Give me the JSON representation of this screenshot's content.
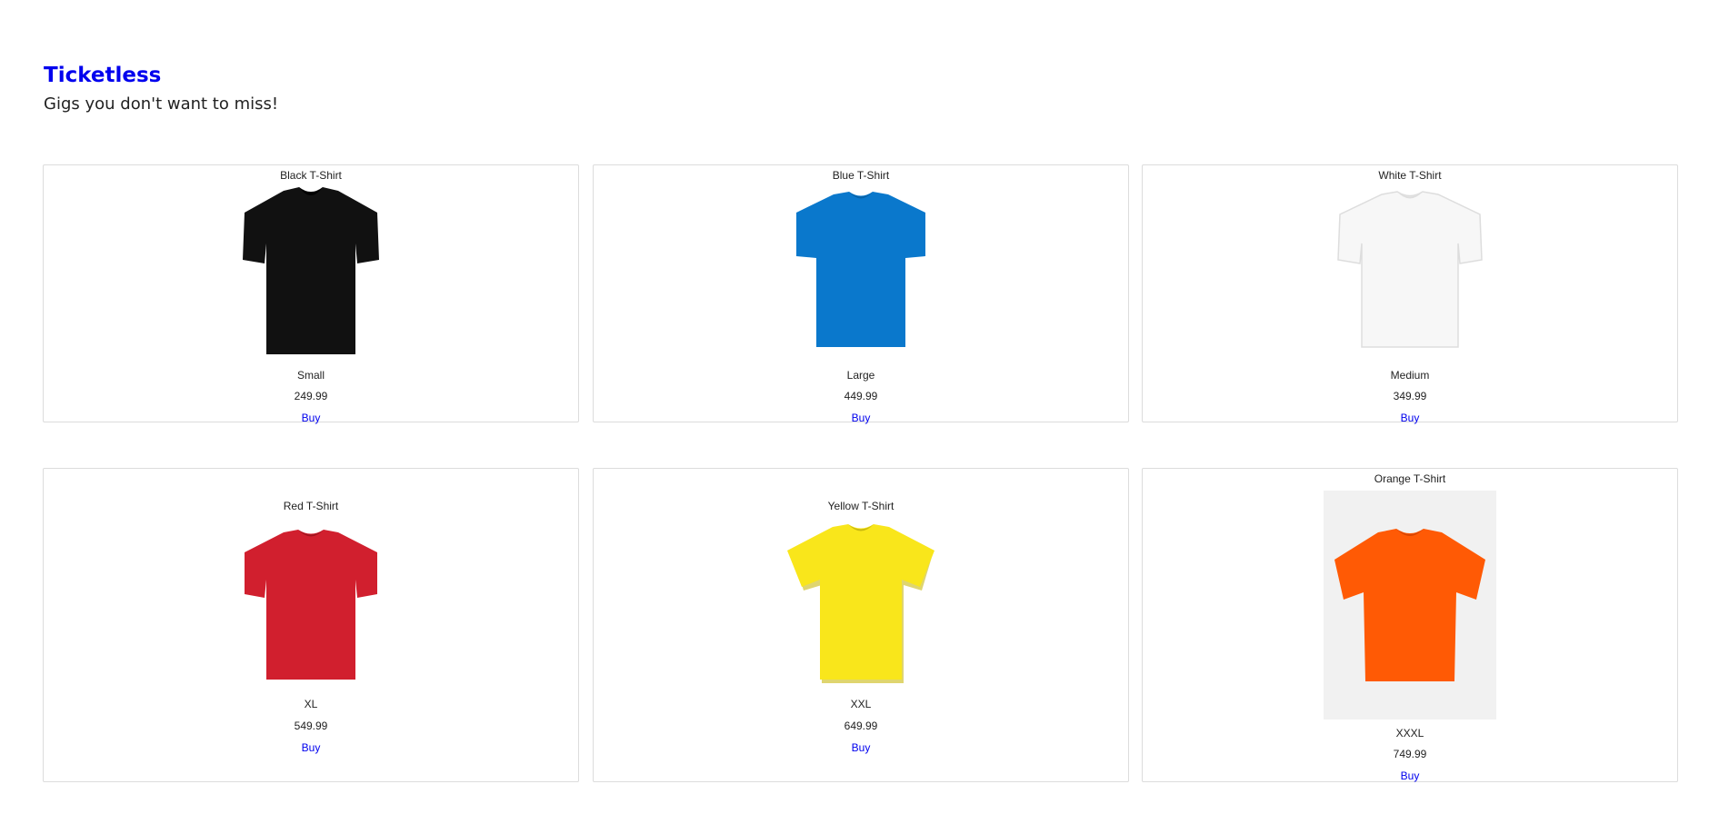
{
  "header": {
    "brand": "Ticketless",
    "tagline": "Gigs you don't want to miss!"
  },
  "colors": {
    "brand": "#0000ee",
    "link": "#0000ee",
    "card_border": "#dcdcdc"
  },
  "products": [
    {
      "title": "Black T-Shirt",
      "size": "Small",
      "price": "249.99",
      "buy_label": "Buy",
      "shirt_color": "#111111",
      "shirt_shade": "#000000",
      "image_bg": "#ffffff",
      "image_icon": "black-tshirt-icon"
    },
    {
      "title": "Blue T-Shirt",
      "size": "Large",
      "price": "449.99",
      "buy_label": "Buy",
      "shirt_color": "#0a78cc",
      "shirt_shade": "#0762a8",
      "image_bg": "#ffffff",
      "image_icon": "blue-tshirt-icon"
    },
    {
      "title": "White T-Shirt",
      "size": "Medium",
      "price": "349.99",
      "buy_label": "Buy",
      "shirt_color": "#f7f7f7",
      "shirt_shade": "#dddddd",
      "image_bg": "#ffffff",
      "image_icon": "white-tshirt-icon"
    },
    {
      "title": "Red T-Shirt",
      "size": "XL",
      "price": "549.99",
      "buy_label": "Buy",
      "shirt_color": "#d11f2e",
      "shirt_shade": "#a3141f",
      "image_bg": "#ffffff",
      "image_icon": "red-tshirt-icon"
    },
    {
      "title": "Yellow T-Shirt",
      "size": "XXL",
      "price": "649.99",
      "buy_label": "Buy",
      "shirt_color": "#f9e61b",
      "shirt_shade": "#c9b90f",
      "image_bg": "#ffffff",
      "image_icon": "yellow-tshirt-icon"
    },
    {
      "title": "Orange T-Shirt",
      "size": "XXXL",
      "price": "749.99",
      "buy_label": "Buy",
      "shirt_color": "#ff5a05",
      "shirt_shade": "#d94600",
      "image_bg": "#f1f1f1",
      "image_icon": "orange-tshirt-icon"
    }
  ]
}
